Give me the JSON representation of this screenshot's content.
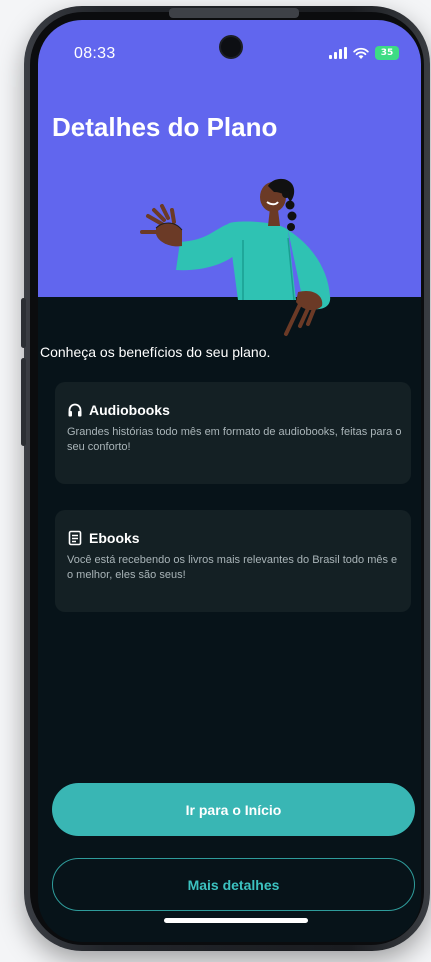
{
  "status_bar": {
    "time": "08:33",
    "battery": "35",
    "icons": [
      "signal-icon",
      "wifi-icon",
      "battery-icon"
    ]
  },
  "header": {
    "title": "Detalhes do Plano",
    "background_color": "#6166ee"
  },
  "intro_text": "Conheça os benefícios do seu plano.",
  "benefits": [
    {
      "icon": "headphones-icon",
      "title": "Audiobooks",
      "description": "Grandes histórias todo mês em formato de audiobooks, feitas para o seu conforto!"
    },
    {
      "icon": "book-icon",
      "title": "Ebooks",
      "description": "Você está recebendo os livros mais relevantes do Brasil todo mês e o melhor, eles são seus!"
    }
  ],
  "actions": {
    "primary_label": "Ir para o Início",
    "secondary_label": "Mais detalhes"
  },
  "colors": {
    "accent": "#39b6b4",
    "background": "#071319",
    "card": "#142024",
    "illustration_shirt": "#2fc2b3"
  }
}
